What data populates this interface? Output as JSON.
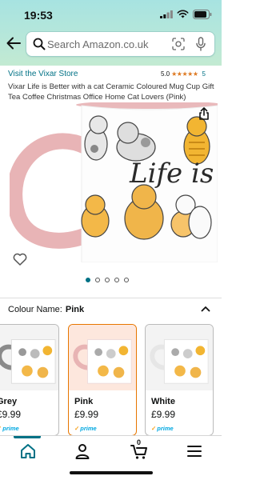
{
  "status_bar": {
    "time": "19:53"
  },
  "header": {
    "search_placeholder": "Search Amazon.co.uk"
  },
  "product": {
    "store_link": "Visit the Vixar Store",
    "rating_value": "5.0",
    "rating_stars": "★★★★★",
    "rating_count": "5",
    "title": "Vixar Life is Better with a cat Ceramic Coloured Mug Cup Gift Tea Coffee Christmas Office Home Cat Lovers (Pink)",
    "image_text": "Life is B",
    "image_index": 1,
    "image_count": 5
  },
  "colour": {
    "label": "Colour Name:",
    "selected": "Pink"
  },
  "swatches": [
    {
      "name": "Grey",
      "price": "£9.99",
      "prime": "prime",
      "handle_color": "#8a8a8a"
    },
    {
      "name": "Pink",
      "price": "£9.99",
      "prime": "prime",
      "handle_color": "#e8b4b4"
    },
    {
      "name": "White",
      "price": "£9.99",
      "prime": "prime",
      "handle_color": "#e6e6e6"
    }
  ],
  "bottom_nav": {
    "cart_count": "0"
  },
  "colors": {
    "accent": "#007185",
    "selected_border": "#e77600",
    "star": "#de7921",
    "prime": "#00a8e1"
  }
}
